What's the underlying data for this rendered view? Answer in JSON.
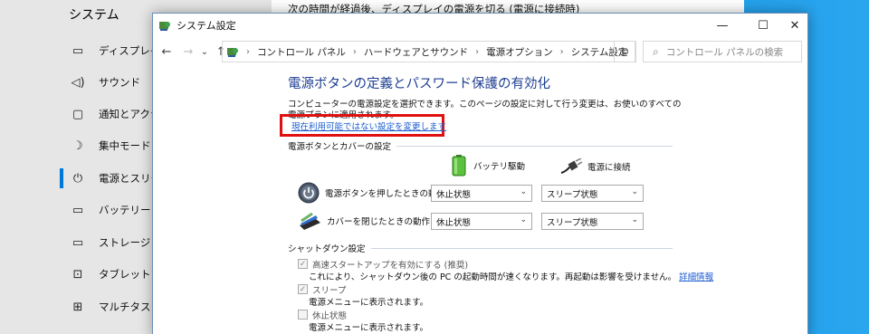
{
  "background_app": {
    "title": "システム",
    "main_text": "次の時間が経過後、ディスプレイの電源を切る (電源に接続時)",
    "items": [
      {
        "icon": "monitor-icon",
        "glyph": "▭",
        "label": "ディスプレイ"
      },
      {
        "icon": "speaker-icon",
        "glyph": "◁)",
        "label": "サウンド"
      },
      {
        "icon": "notification-icon",
        "glyph": "▢",
        "label": "通知とアクション"
      },
      {
        "icon": "moon-icon",
        "glyph": "☽",
        "label": "集中モード"
      },
      {
        "icon": "power-icon",
        "glyph": "⏻",
        "label": "電源とスリープ"
      },
      {
        "icon": "battery-icon",
        "glyph": "▭",
        "label": "バッテリー"
      },
      {
        "icon": "storage-icon",
        "glyph": "▭",
        "label": "ストレージ"
      },
      {
        "icon": "tablet-icon",
        "glyph": "⊡",
        "label": "タブレット モード"
      },
      {
        "icon": "multitask-icon",
        "glyph": "⊞",
        "label": "マルチタスク"
      }
    ],
    "active_index": 4
  },
  "window": {
    "title": "システム設定",
    "buttons": {
      "minimize": "—",
      "maximize": "☐",
      "close": "✕"
    }
  },
  "nav": {
    "back": "←",
    "forward": "→",
    "down": "⌄",
    "up": "↑",
    "breadcrumbs": [
      "コントロール パネル",
      "ハードウェアとサウンド",
      "電源オプション",
      "システム設定"
    ],
    "refresh": "↻",
    "search_placeholder": "コントロール パネルの検索"
  },
  "content": {
    "title": "電源ボタンの定義とパスワード保護の有効化",
    "description": "コンピューターの電源設定を選択できます。このページの設定に対して行う変更は、お使いのすべての電源プランに適用されます。",
    "change_link": "現在利用可能ではない設定を変更します",
    "section_power": "電源ボタンとカバーの設定",
    "col_battery": "バッテリ駆動",
    "col_plugged": "電源に接続",
    "rows": [
      {
        "label": "電源ボタンを押したときの動作:",
        "battery": "休止状態",
        "plugged": "スリープ状態"
      },
      {
        "label": "カバーを閉じたときの動作:",
        "battery": "休止状態",
        "plugged": "スリープ状態"
      }
    ],
    "section_shutdown": "シャットダウン設定",
    "shutdown_items": [
      {
        "label": "高速スタートアップを有効にする (推奨)",
        "checked": true,
        "desc": "これにより、シャットダウン後の PC の起動時間が速くなります。再起動は影響を受けません。",
        "link": "詳細情報"
      },
      {
        "label": "スリープ",
        "checked": true,
        "desc": "電源メニューに表示されます。"
      },
      {
        "label": "休止状態",
        "checked": false,
        "desc": "電源メニューに表示されます。"
      }
    ]
  },
  "colors": {
    "accent": "#0078d7",
    "title": "#1e3f91",
    "link": "#1a5bd0",
    "highlight": "#e01010"
  }
}
